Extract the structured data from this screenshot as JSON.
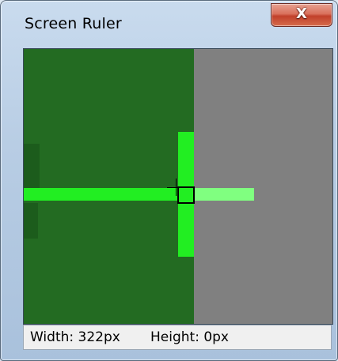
{
  "window": {
    "title": "Screen Ruler",
    "close_label": "X"
  },
  "status": {
    "width_text": "Width: 322px",
    "height_text": "Height: 0px"
  },
  "colors": {
    "magnified_green": "#236b22",
    "crosshair_green": "#22ee22",
    "crosshair_light_green": "#80ff80",
    "background_gray": "#808080",
    "close_button": "#c1402b"
  },
  "icons": {
    "close": "close-icon",
    "crosshair": "crosshair-cursor-icon"
  }
}
